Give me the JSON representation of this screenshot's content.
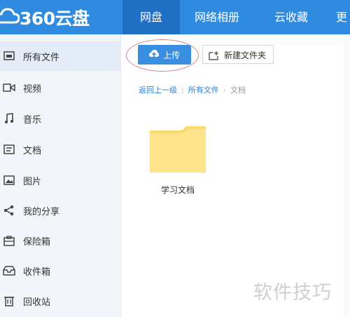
{
  "app": {
    "logo_text": "360云盘"
  },
  "nav": [
    {
      "label": "网盘",
      "active": true
    },
    {
      "label": "网络相册"
    },
    {
      "label": "云收藏"
    },
    {
      "label": "更"
    }
  ],
  "sidebar": {
    "items": [
      {
        "label": "所有文件",
        "icon": "file-icon",
        "active": true
      },
      {
        "label": "视频",
        "icon": "video-icon"
      },
      {
        "label": "音乐",
        "icon": "music-icon"
      },
      {
        "label": "文档",
        "icon": "document-icon"
      },
      {
        "label": "图片",
        "icon": "image-icon"
      },
      {
        "label": "我的分享",
        "icon": "share-icon"
      },
      {
        "label": "保险箱",
        "icon": "safe-icon"
      },
      {
        "label": "收件箱",
        "icon": "inbox-icon"
      },
      {
        "label": "回收站",
        "icon": "trash-icon"
      }
    ]
  },
  "toolbar": {
    "upload_label": "上传",
    "new_folder_label": "新建文件夹"
  },
  "breadcrumb": {
    "back": "返回上一级",
    "root": "所有文件",
    "current": "文档",
    "separator": "›"
  },
  "files": [
    {
      "name": "学习文档",
      "type": "folder"
    }
  ],
  "watermark": "软件技巧",
  "colors": {
    "accent": "#2f8be0",
    "nav_active": "#1f6fc6",
    "folder": "#fde38a"
  }
}
